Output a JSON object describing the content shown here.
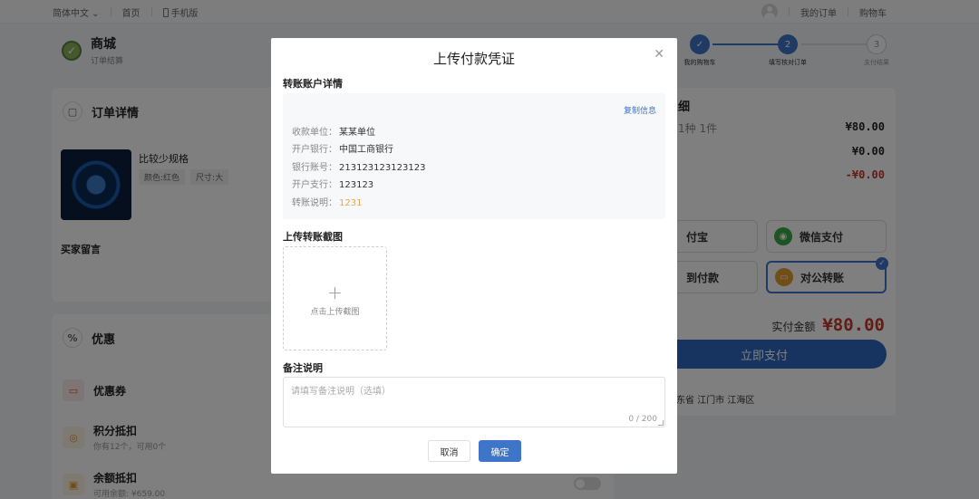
{
  "topbar": {
    "language": "简体中文",
    "home": "首页",
    "mobile": "手机版",
    "my_orders": "我的订单",
    "cart": "购物车"
  },
  "header": {
    "title": "商城",
    "subtitle": "订单结算"
  },
  "steps": [
    {
      "index": "✓",
      "label": "我的购物车"
    },
    {
      "index": "2",
      "label": "填写核对订单"
    },
    {
      "index": "3",
      "label": "支付结果"
    }
  ],
  "order": {
    "title": "订单详情",
    "product_name": "比较少规格",
    "tags": [
      "颜色:红色",
      "尺寸:大"
    ],
    "buyer_note_label": "买家留言"
  },
  "promo": {
    "title": "优惠",
    "coupon": "优惠券",
    "points_title": "积分抵扣",
    "points_sub": "你有12个，可用0个",
    "balance_title": "余额抵扣",
    "balance_sub": "可用余额: ¥659.00"
  },
  "summary": {
    "title_partial": "细",
    "count_partial": "1种 1件",
    "v1": "¥80.00",
    "v2": "¥0.00",
    "v3": "-¥0.00",
    "pay_alipay_partial": "付宝",
    "pay_wechat": "微信支付",
    "pay_cod_partial": "到付款",
    "pay_corporate": "对公转账",
    "actual_label": "实付金额",
    "actual_value": "¥80.00",
    "pay_button": "立即支付",
    "address_partial": "东省 江门市 江海区"
  },
  "modal": {
    "title": "上传付款凭证",
    "account_section": "转账账户详情",
    "copy_info": "复制信息",
    "fields": [
      {
        "k": "收款单位：",
        "v": "某某单位"
      },
      {
        "k": "开户银行：",
        "v": "中国工商银行"
      },
      {
        "k": "银行账号：",
        "v": "213123123123123"
      },
      {
        "k": "开户支行：",
        "v": "123123"
      },
      {
        "k": "转账说明：",
        "v": "1231"
      }
    ],
    "upload_section": "上传转账截图",
    "upload_hint": "点击上传截图",
    "remark_section": "备注说明",
    "remark_placeholder": "请填写备注说明（选填）",
    "remark_counter": "0 / 200",
    "cancel": "取消",
    "confirm": "确定"
  },
  "colors": {
    "primary": "#3f75c9",
    "price_red": "#c0392b",
    "note_orange": "#f0a34a"
  }
}
